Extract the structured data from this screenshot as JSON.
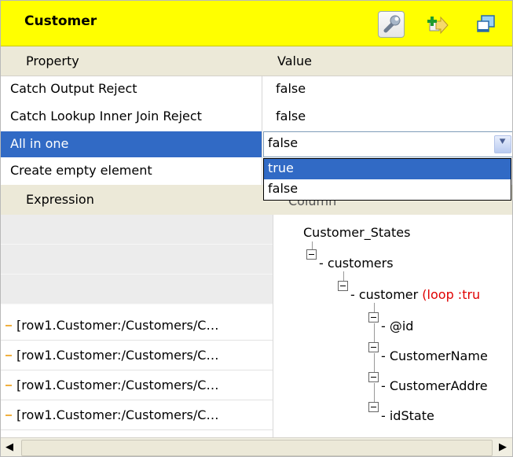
{
  "panel": {
    "title": "Customer"
  },
  "toolbar": {
    "icons": [
      "wrench-icon",
      "add-output-icon",
      "window-icon"
    ]
  },
  "properties": {
    "header_property": "Property",
    "header_value": "Value",
    "rows": [
      {
        "key": "Catch Output Reject",
        "value": "false"
      },
      {
        "key": "Catch Lookup Inner Join Reject",
        "value": "false"
      },
      {
        "key": "All in one",
        "value": "false"
      },
      {
        "key": "Create empty element",
        "value": ""
      }
    ],
    "dropdown_options": [
      "true",
      "false"
    ],
    "dropdown_selected": "true"
  },
  "mapping": {
    "header_expression": "Expression",
    "header_column": "Column",
    "expressions": [
      "",
      "",
      "",
      "[row1.Customer:/Customers/C…",
      "[row1.Customer:/Customers/C…",
      "[row1.Customer:/Customers/C…",
      "[row1.Customer:/Customers/C…"
    ],
    "tree": {
      "root": "Customer_States",
      "level1": "customers",
      "level2": "customer",
      "level2_note": "(loop :tru",
      "leaves": [
        "@id",
        "CustomerName",
        "CustomerAddre",
        "idState"
      ]
    }
  },
  "colors": {
    "title_bg": "#ffff00",
    "selection": "#316ac5",
    "loop_note": "#e00000"
  }
}
